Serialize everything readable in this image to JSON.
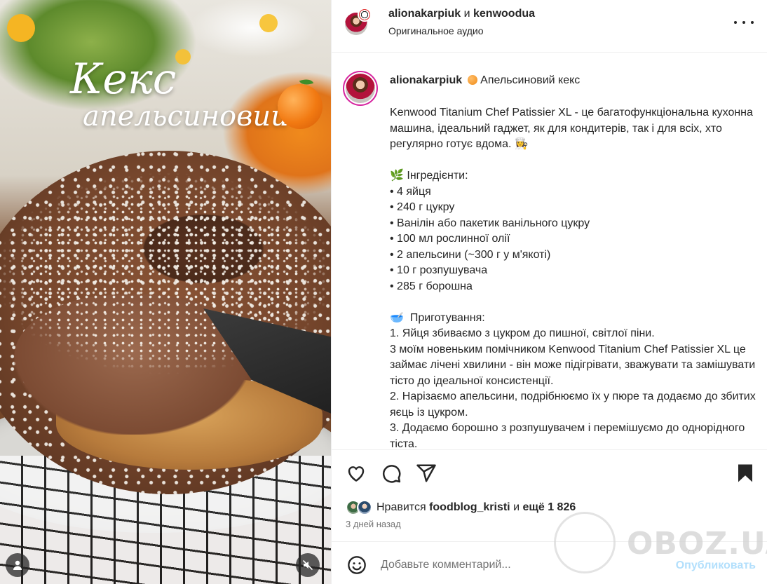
{
  "media": {
    "title_line1": "Кекс",
    "title_line2": "апельсиновий"
  },
  "header": {
    "user1": "alionakarpiuk",
    "joiner": "и",
    "user2": "kenwoodua",
    "audio": "Оригинальное аудио"
  },
  "caption": {
    "username": "alionakarpiuk",
    "title": "Апельсиновий кекс",
    "body": "Kenwood Titanium Chef Patissier XL - це багатофункціональна кухонна машина, ідеальний гаджет, як для кондитерів, так і для всіх, хто регулярно готує вдома. 👩‍🍳\n\n🌿 Інгредієнти:\n• 4 яйця\n• 240 г цукру\n• Ванілін або пакетик ванільного цукру\n• 100 мл рослинної олії\n• 2 апельсини (~300 г у м'якоті)\n• 10 г розпушувача\n• 285 г борошна\n\n🥣  Приготування:\n1. Яйця збиваємо з цукром до пишної, світлої піни.\n3 моїм новеньким помічником Kenwood Titanium Chef Patissier XL це займає лічені хвилини - він може підігрівати, зважувати та замішувати тісто до ідеальної консистенції.\n2. Нарізаємо апельсини, подрібнюємо їх у пюре та додаємо до збитих яєць із цукром.\n3. Додаємо борошно з розпушувачем і перемішуємо до однорідного тіста."
  },
  "likes": {
    "prefix": "Нравится",
    "user": "foodblog_kristi",
    "middle": "и",
    "suffix": "ещё 1 826"
  },
  "time_ago": "3 дней назад",
  "comment": {
    "placeholder": "Добавьте комментарий...",
    "publish": "Опубликовать"
  },
  "watermark": "OBOZ.UA",
  "colors": {
    "text": "#262626",
    "secondary": "#737373",
    "publish_disabled": "#b2dffc",
    "story_ring": "#d6249f"
  },
  "icons": [
    "heart-icon",
    "comment-icon",
    "share-icon",
    "bookmark-icon",
    "emoji-icon",
    "more-icon",
    "user-tag-icon",
    "muted-icon"
  ]
}
